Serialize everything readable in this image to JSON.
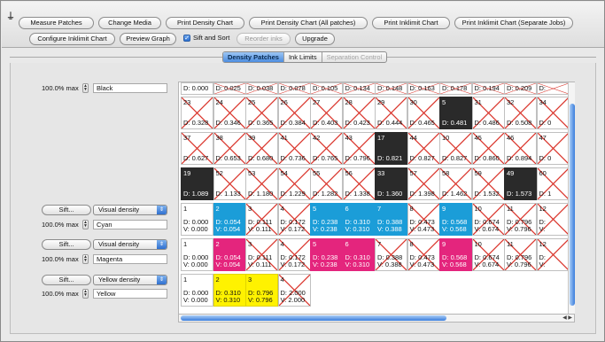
{
  "toolbar": {
    "pin_glyph": "⍊",
    "buttons": {
      "measure": "Measure Patches",
      "change_media": "Change Media",
      "print_density": "Print Density Chart",
      "print_density_all": "Print Density Chart (All patches)",
      "print_inklimit": "Print Inklimit Chart",
      "print_inklimit_separate": "Print Inklimit Chart (Separate Jobs)",
      "configure_inklimit": "Configure Inklimit Chart",
      "preview_graph": "Preview Graph",
      "reorder_inks": "Reorder inks",
      "upgrade": "Upgrade"
    },
    "sift_and_sort": {
      "label": "Sift and Sort",
      "checked": true
    }
  },
  "tabs": [
    {
      "label": "Density Patches",
      "state": "active"
    },
    {
      "label": "Ink Limits",
      "state": "normal"
    },
    {
      "label": "Separation Control",
      "state": "disabled"
    }
  ],
  "channels": [
    {
      "max": "100.0% max",
      "name": "Black",
      "sift": "",
      "density_mode": ""
    },
    {
      "max": "100.0% max",
      "name": "Cyan",
      "sift": "Sift...",
      "density_mode": "Visual density"
    },
    {
      "max": "100.0% max",
      "name": "Magenta",
      "sift": "Sift...",
      "density_mode": "Visual density"
    },
    {
      "max": "100.0% max",
      "name": "Yellow",
      "sift": "Sift...",
      "density_mode": "Yellow density"
    }
  ],
  "black_rows": [
    [
      "D: 0.000",
      "D: 0.025",
      "D: 0.038",
      "D: 0.078",
      "D: 0.105",
      "D: 0.134",
      "D: 0.148",
      "D: 0.163",
      "D: 0.178",
      "D: 0.194",
      "D: 0.209",
      "D:"
    ],
    [
      {
        "n": "23",
        "d": "D: 0.328",
        "x": true
      },
      {
        "n": "24",
        "d": "D: 0.346",
        "x": true
      },
      {
        "n": "25",
        "d": "D: 0.365",
        "x": true
      },
      {
        "n": "26",
        "d": "D: 0.384",
        "x": true
      },
      {
        "n": "27",
        "d": "D: 0.403",
        "x": true
      },
      {
        "n": "28",
        "d": "D: 0.423",
        "x": true
      },
      {
        "n": "29",
        "d": "D: 0.444",
        "x": true
      },
      {
        "n": "30",
        "d": "D: 0.465",
        "x": true
      },
      {
        "n": "5",
        "d": "D: 0.481",
        "x": false
      },
      {
        "n": "31",
        "d": "D: 0.486",
        "x": true
      },
      {
        "n": "32",
        "d": "D: 0.508",
        "x": true
      },
      {
        "n": "34",
        "d": "D: 0",
        "x": true
      }
    ],
    [
      {
        "n": "37",
        "d": "D: 0.627",
        "x": true
      },
      {
        "n": "38",
        "d": "D: 0.653",
        "x": true
      },
      {
        "n": "39",
        "d": "D: 0.680",
        "x": true
      },
      {
        "n": "41",
        "d": "D: 0.736",
        "x": true
      },
      {
        "n": "42",
        "d": "D: 0.765",
        "x": true
      },
      {
        "n": "43",
        "d": "D: 0.796",
        "x": true
      },
      {
        "n": "17",
        "d": "D: 0.821",
        "x": false
      },
      {
        "n": "44",
        "d": "D: 0.827",
        "x": true
      },
      {
        "n": "10",
        "d": "D: 0.827",
        "x": true
      },
      {
        "n": "45",
        "d": "D: 0.860",
        "x": true
      },
      {
        "n": "46",
        "d": "D: 0.894",
        "x": true
      },
      {
        "n": "47",
        "d": "D: 0",
        "x": true
      }
    ],
    [
      {
        "n": "19",
        "d": "D: 1.089",
        "x": false
      },
      {
        "n": "52",
        "d": "D: 1.133",
        "x": true
      },
      {
        "n": "53",
        "d": "D: 1.180",
        "x": true
      },
      {
        "n": "54",
        "d": "D: 1.229",
        "x": true
      },
      {
        "n": "55",
        "d": "D: 1.282",
        "x": true
      },
      {
        "n": "56",
        "d": "D: 1.338",
        "x": true
      },
      {
        "n": "33",
        "d": "D: 1.360",
        "x": false
      },
      {
        "n": "57",
        "d": "D: 1.398",
        "x": true
      },
      {
        "n": "58",
        "d": "D: 1.462",
        "x": true
      },
      {
        "n": "59",
        "d": "D: 1.532",
        "x": true
      },
      {
        "n": "49",
        "d": "D: 1.573",
        "x": false
      },
      {
        "n": "60",
        "d": "D: 1",
        "x": true
      }
    ]
  ],
  "cyan_row": [
    {
      "n": "1",
      "d": "D: 0.000",
      "v": "V: 0.000",
      "x": false,
      "fill": false
    },
    {
      "n": "2",
      "d": "D: 0.054",
      "v": "V: 0.054",
      "x": false,
      "fill": true
    },
    {
      "n": "3",
      "d": "D: 0.111",
      "v": "V: 0.111",
      "x": true,
      "fill": false
    },
    {
      "n": "4",
      "d": "D: 0.172",
      "v": "V: 0.172",
      "x": true,
      "fill": false
    },
    {
      "n": "5",
      "d": "D: 0.238",
      "v": "V: 0.238",
      "x": false,
      "fill": true
    },
    {
      "n": "6",
      "d": "D: 0.310",
      "v": "V: 0.310",
      "x": false,
      "fill": true
    },
    {
      "n": "7",
      "d": "D: 0.388",
      "v": "V: 0.388",
      "x": false,
      "fill": true
    },
    {
      "n": "8",
      "d": "D: 0.473",
      "v": "V: 0.473",
      "x": true,
      "fill": false
    },
    {
      "n": "9",
      "d": "D: 0.568",
      "v": "V: 0.568",
      "x": false,
      "fill": true
    },
    {
      "n": "10",
      "d": "D: 0.674",
      "v": "V: 0.674",
      "x": true,
      "fill": false
    },
    {
      "n": "11",
      "d": "D: 0.796",
      "v": "V: 0.796",
      "x": true,
      "fill": false
    },
    {
      "n": "12",
      "d": "D:",
      "v": "V:",
      "x": true,
      "fill": false
    }
  ],
  "magenta_row": [
    {
      "n": "1",
      "d": "D: 0.000",
      "v": "V: 0.000",
      "x": false,
      "fill": false
    },
    {
      "n": "2",
      "d": "D: 0.054",
      "v": "V: 0.054",
      "x": false,
      "fill": true
    },
    {
      "n": "3",
      "d": "D: 0.111",
      "v": "V: 0.111",
      "x": true,
      "fill": false
    },
    {
      "n": "4",
      "d": "D: 0.172",
      "v": "V: 0.172",
      "x": true,
      "fill": false
    },
    {
      "n": "5",
      "d": "D: 0.238",
      "v": "V: 0.238",
      "x": false,
      "fill": true
    },
    {
      "n": "6",
      "d": "D: 0.310",
      "v": "V: 0.310",
      "x": false,
      "fill": true
    },
    {
      "n": "7",
      "d": "D: 0.388",
      "v": "V: 0.388",
      "x": true,
      "fill": false
    },
    {
      "n": "8",
      "d": "D: 0.473",
      "v": "V: 0.473",
      "x": true,
      "fill": false
    },
    {
      "n": "9",
      "d": "D: 0.568",
      "v": "V: 0.568",
      "x": false,
      "fill": true
    },
    {
      "n": "10",
      "d": "D: 0.674",
      "v": "V: 0.674",
      "x": true,
      "fill": false
    },
    {
      "n": "11",
      "d": "D: 0.796",
      "v": "V: 0.796",
      "x": true,
      "fill": false
    },
    {
      "n": "12",
      "d": "D:",
      "v": "V:",
      "x": true,
      "fill": false
    }
  ],
  "yellow_row": [
    {
      "n": "1",
      "d": "D: 0.000",
      "v": "V: 0.000",
      "x": false,
      "fill": false
    },
    {
      "n": "2",
      "d": "D: 0.310",
      "v": "V: 0.310",
      "x": false,
      "fill": true
    },
    {
      "n": "3",
      "d": "D: 0.796",
      "v": "V: 0.796",
      "x": false,
      "fill": true
    },
    {
      "n": "4",
      "d": "D: 2.000",
      "v": "V: 2.000",
      "x": true,
      "fill": false
    }
  ],
  "colors": {
    "black": "#2a2a2a",
    "cyan": "#1b9dd8",
    "magenta": "#e4257d",
    "yellow": "#fff200",
    "cross": "#d9342b",
    "accent": "#3b7ddc"
  }
}
